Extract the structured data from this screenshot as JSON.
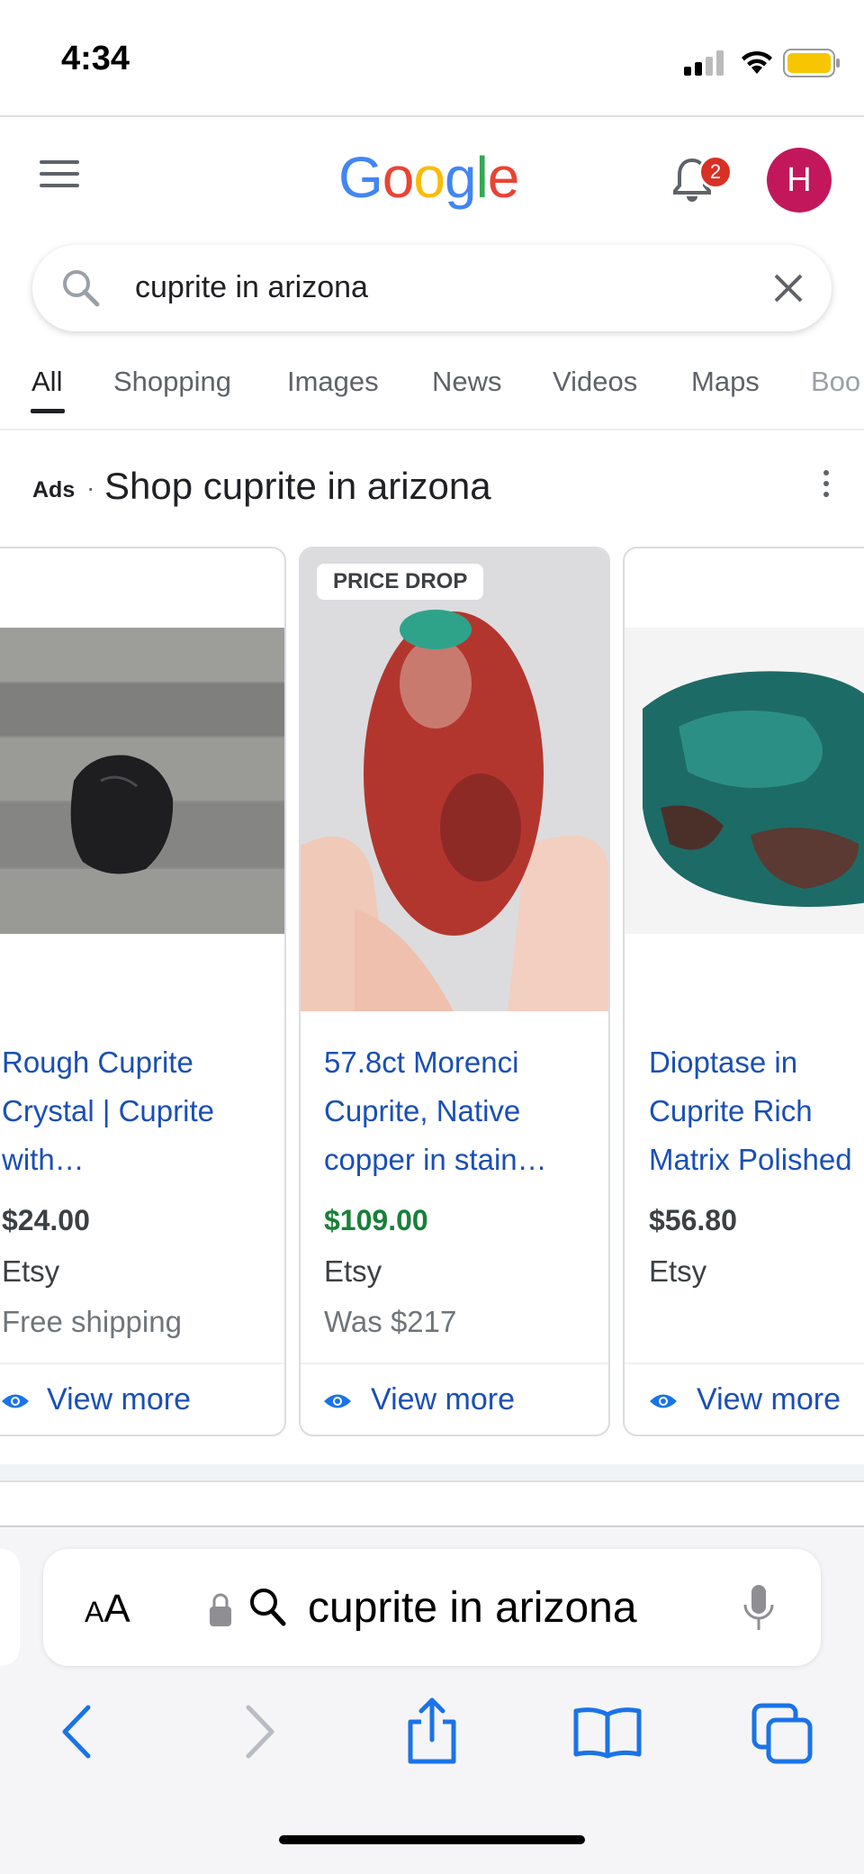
{
  "status_bar": {
    "time": "4:34"
  },
  "header": {
    "logo_letters": [
      {
        "ch": "G",
        "color": "#4285F4"
      },
      {
        "ch": "o",
        "color": "#EA4335"
      },
      {
        "ch": "o",
        "color": "#FBBC05"
      },
      {
        "ch": "g",
        "color": "#4285F4"
      },
      {
        "ch": "l",
        "color": "#34A853"
      },
      {
        "ch": "e",
        "color": "#EA4335"
      }
    ],
    "notification_count": "2",
    "avatar_initial": "H"
  },
  "search": {
    "query": "cuprite in arizona"
  },
  "tabs": [
    "All",
    "Shopping",
    "Images",
    "News",
    "Videos",
    "Maps",
    "Boo"
  ],
  "ads": {
    "label": "Ads",
    "dot": "·",
    "title": "Shop cuprite in arizona",
    "cards": [
      {
        "title": "Rough Cuprite Crystal | Cuprite with…",
        "price": "$24.00",
        "store": "Etsy",
        "extra": "Free shipping",
        "view_more": "View more"
      },
      {
        "badge": "PRICE DROP",
        "title": "57.8ct Morenci Cuprite, Native copper in stain…",
        "price": "$109.00",
        "store": "Etsy",
        "extra": "Was $217",
        "view_more": "View more"
      },
      {
        "title": "Dioptase in Cuprite Rich Matrix Polished",
        "price": "$56.80",
        "store": "Etsy",
        "extra": "",
        "view_more": "View more"
      }
    ]
  },
  "browser": {
    "aa_big": "A",
    "aa_small": "A",
    "url_text": "cuprite in arizona"
  },
  "colors": {
    "link": "#1a4fb5",
    "price_drop": "#188038",
    "ios_blue": "#1a73e8"
  }
}
